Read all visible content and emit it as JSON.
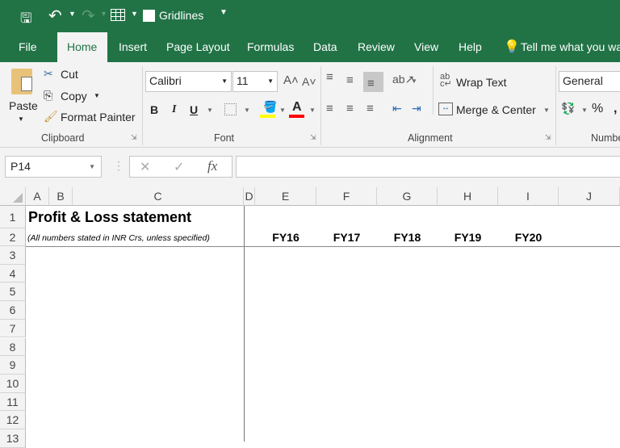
{
  "qat": {
    "gridlines_label": "Gridlines",
    "gridlines_checked": false
  },
  "tabs": [
    "File",
    "Home",
    "Insert",
    "Page Layout",
    "Formulas",
    "Data",
    "Review",
    "View",
    "Help"
  ],
  "tell_me": "Tell me what you wa",
  "clipboard": {
    "paste": "Paste",
    "cut": "Cut",
    "copy": "Copy",
    "format_painter": "Format Painter",
    "label": "Clipboard"
  },
  "font": {
    "name": "Calibri",
    "size": "11",
    "label": "Font",
    "bold": "B",
    "italic": "I",
    "underline": "U",
    "font_color_letter": "A",
    "highlight_color": "#ffff00",
    "font_color": "#ff0000"
  },
  "alignment": {
    "wrap_text": "Wrap Text",
    "merge_center": "Merge & Center",
    "label": "Alignment"
  },
  "number": {
    "format": "General",
    "percent": "%",
    "label": "Numbe"
  },
  "formula_bar": {
    "name_box": "P14",
    "fx": "fx",
    "value": ""
  },
  "columns": [
    "A",
    "B",
    "C",
    "D",
    "E",
    "F",
    "G",
    "H",
    "I",
    "J"
  ],
  "rows": [
    "1",
    "2",
    "3",
    "4",
    "5",
    "6",
    "7",
    "8",
    "9",
    "10",
    "11",
    "12",
    "13"
  ],
  "cells": {
    "C1": "Profit & Loss statement",
    "C2": "(All numbers stated in INR Crs, unless specified)",
    "years": [
      "FY16",
      "FY17",
      "FY18",
      "FY19",
      "FY20"
    ]
  },
  "colors": {
    "excel_green": "#217346"
  }
}
